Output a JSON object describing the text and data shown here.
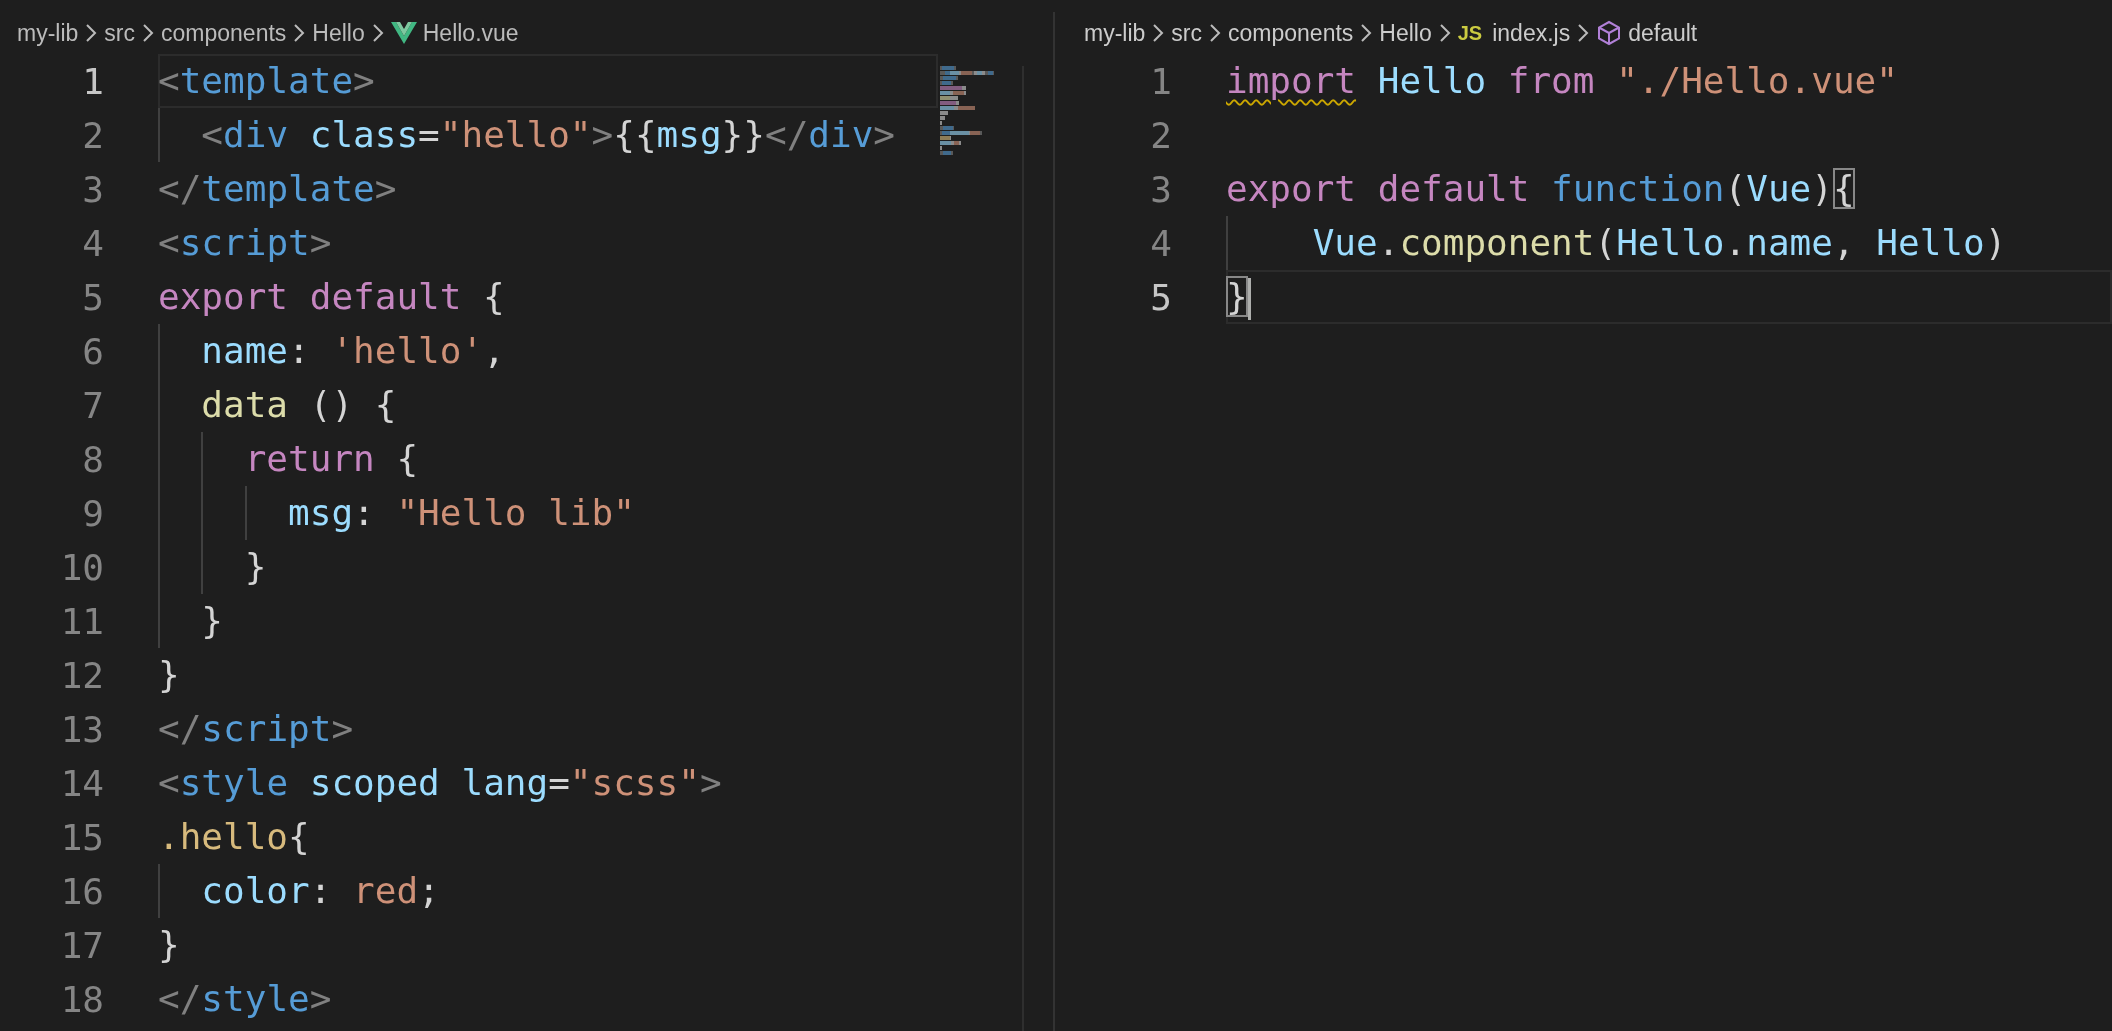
{
  "editors": [
    {
      "active": false,
      "minimap": true,
      "breadcrumbs": [
        {
          "kind": "folder",
          "label": "my-lib"
        },
        {
          "kind": "folder",
          "label": "src"
        },
        {
          "kind": "folder",
          "label": "components"
        },
        {
          "kind": "folder",
          "label": "Hello"
        },
        {
          "kind": "vue-file",
          "label": "Hello.vue"
        }
      ],
      "lines": [
        {
          "number": "1",
          "current": true,
          "tokens": [
            {
              "color": "#808080",
              "t": "<"
            },
            {
              "color": "#569cd6",
              "t": "template"
            },
            {
              "color": "#808080",
              "t": ">"
            }
          ]
        },
        {
          "number": "2",
          "current": false,
          "tokens": [
            {
              "color": "#808080",
              "t": "  <"
            },
            {
              "color": "#569cd6",
              "t": "div"
            },
            {
              "color": "#9cdcfe",
              "t": " class"
            },
            {
              "color": "#d4d4d4",
              "t": "="
            },
            {
              "color": "#ce9178",
              "t": "\"hello\""
            },
            {
              "color": "#808080",
              "t": ">"
            },
            {
              "color": "#d4d4d4",
              "t": "{{"
            },
            {
              "color": "#9cdcfe",
              "t": "msg"
            },
            {
              "color": "#d4d4d4",
              "t": "}}"
            },
            {
              "color": "#808080",
              "t": "</"
            },
            {
              "color": "#569cd6",
              "t": "div"
            },
            {
              "color": "#808080",
              "t": ">"
            }
          ]
        },
        {
          "number": "3",
          "current": false,
          "tokens": [
            {
              "color": "#808080",
              "t": "</"
            },
            {
              "color": "#569cd6",
              "t": "template"
            },
            {
              "color": "#808080",
              "t": ">"
            }
          ]
        },
        {
          "number": "4",
          "current": false,
          "tokens": [
            {
              "color": "#808080",
              "t": "<"
            },
            {
              "color": "#569cd6",
              "t": "script"
            },
            {
              "color": "#808080",
              "t": ">"
            }
          ]
        },
        {
          "number": "5",
          "current": false,
          "tokens": [
            {
              "color": "#c586c0",
              "t": "export default"
            },
            {
              "color": "#d4d4d4",
              "t": " {"
            }
          ]
        },
        {
          "number": "6",
          "current": false,
          "tokens": [
            {
              "color": "#9cdcfe",
              "t": "  name"
            },
            {
              "color": "#d4d4d4",
              "t": ": "
            },
            {
              "color": "#ce9178",
              "t": "'hello'"
            },
            {
              "color": "#d4d4d4",
              "t": ","
            }
          ]
        },
        {
          "number": "7",
          "current": false,
          "tokens": [
            {
              "color": "#dcdcaa",
              "t": "  data"
            },
            {
              "color": "#d4d4d4",
              "t": " () {"
            }
          ]
        },
        {
          "number": "8",
          "current": false,
          "tokens": [
            {
              "color": "#c586c0",
              "t": "    return"
            },
            {
              "color": "#d4d4d4",
              "t": " {"
            }
          ]
        },
        {
          "number": "9",
          "current": false,
          "tokens": [
            {
              "color": "#9cdcfe",
              "t": "      msg"
            },
            {
              "color": "#d4d4d4",
              "t": ": "
            },
            {
              "color": "#ce9178",
              "t": "\"Hello lib\""
            }
          ]
        },
        {
          "number": "10",
          "current": false,
          "tokens": [
            {
              "color": "#d4d4d4",
              "t": "    }"
            }
          ]
        },
        {
          "number": "11",
          "current": false,
          "tokens": [
            {
              "color": "#d4d4d4",
              "t": "  }"
            }
          ]
        },
        {
          "number": "12",
          "current": false,
          "tokens": [
            {
              "color": "#d4d4d4",
              "t": "}"
            }
          ]
        },
        {
          "number": "13",
          "current": false,
          "tokens": [
            {
              "color": "#808080",
              "t": "</"
            },
            {
              "color": "#569cd6",
              "t": "script"
            },
            {
              "color": "#808080",
              "t": ">"
            }
          ]
        },
        {
          "number": "14",
          "current": false,
          "tokens": [
            {
              "color": "#808080",
              "t": "<"
            },
            {
              "color": "#569cd6",
              "t": "style"
            },
            {
              "color": "#9cdcfe",
              "t": " scoped lang"
            },
            {
              "color": "#d4d4d4",
              "t": "="
            },
            {
              "color": "#ce9178",
              "t": "\"scss\""
            },
            {
              "color": "#808080",
              "t": ">"
            }
          ]
        },
        {
          "number": "15",
          "current": false,
          "tokens": [
            {
              "color": "#d7ba7d",
              "t": ".hello"
            },
            {
              "color": "#d4d4d4",
              "t": "{"
            }
          ]
        },
        {
          "number": "16",
          "current": false,
          "tokens": [
            {
              "color": "#9cdcfe",
              "t": "  color"
            },
            {
              "color": "#d4d4d4",
              "t": ": "
            },
            {
              "color": "#ce9178",
              "t": "red"
            },
            {
              "color": "#d4d4d4",
              "t": ";"
            }
          ]
        },
        {
          "number": "17",
          "current": false,
          "tokens": [
            {
              "color": "#d4d4d4",
              "t": "}"
            }
          ]
        },
        {
          "number": "18",
          "current": false,
          "tokens": [
            {
              "color": "#808080",
              "t": "</"
            },
            {
              "color": "#569cd6",
              "t": "style"
            },
            {
              "color": "#808080",
              "t": ">"
            }
          ]
        }
      ]
    },
    {
      "active": true,
      "breadcrumbs": [
        {
          "kind": "folder",
          "label": "my-lib"
        },
        {
          "kind": "folder",
          "label": "src"
        },
        {
          "kind": "folder",
          "label": "components"
        },
        {
          "kind": "folder",
          "label": "Hello"
        },
        {
          "kind": "js-file",
          "icon_text": "JS",
          "label": "index.js"
        },
        {
          "kind": "symbol",
          "label": "default"
        }
      ],
      "lines": [
        {
          "number": "1",
          "current": false,
          "tokens": [
            {
              "color": "#c586c0",
              "t": "import",
              "squiggle": true
            },
            {
              "color": "#9cdcfe",
              "t": " Hello"
            },
            {
              "color": "#c586c0",
              "t": " from"
            },
            {
              "color": "#ce9178",
              "t": " \"./Hello.vue\""
            }
          ]
        },
        {
          "number": "2",
          "current": false
        },
        {
          "number": "3",
          "current": false,
          "tokens": [
            {
              "color": "#c586c0",
              "t": "export default"
            },
            {
              "color": "#569cd6",
              "t": " function"
            },
            {
              "color": "#d4d4d4",
              "t": "("
            },
            {
              "color": "#9cdcfe",
              "t": "Vue"
            },
            {
              "color": "#d4d4d4",
              "t": ")"
            },
            {
              "color": "#d4d4d4",
              "t": "{",
              "matched": true
            }
          ]
        },
        {
          "number": "4",
          "current": false,
          "tokens": [
            {
              "color": "#9cdcfe",
              "t": "    Vue"
            },
            {
              "color": "#d4d4d4",
              "t": "."
            },
            {
              "color": "#dcdcaa",
              "t": "component"
            },
            {
              "color": "#d4d4d4",
              "t": "("
            },
            {
              "color": "#9cdcfe",
              "t": "Hello"
            },
            {
              "color": "#d4d4d4",
              "t": "."
            },
            {
              "color": "#9cdcfe",
              "t": "name"
            },
            {
              "color": "#d4d4d4",
              "t": ", "
            },
            {
              "color": "#9cdcfe",
              "t": "Hello"
            },
            {
              "color": "#d4d4d4",
              "t": ")"
            }
          ]
        },
        {
          "number": "5",
          "current": true,
          "tokens": [
            {
              "color": "#d4d4d4",
              "t": "}",
              "matched": true
            }
          ]
        }
      ]
    }
  ]
}
